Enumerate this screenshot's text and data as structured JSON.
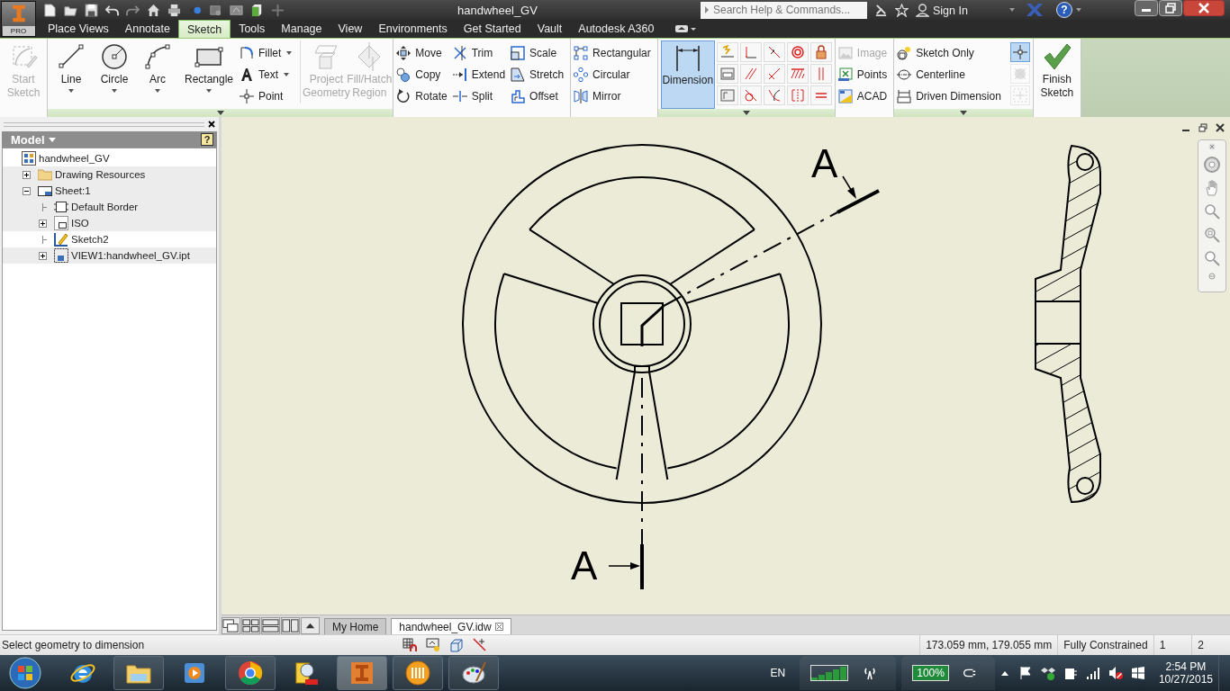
{
  "app_button": {
    "badge": "PRO"
  },
  "title_bar": {
    "title": "handwheel_GV",
    "search": {
      "placeholder": "Search Help & Commands..."
    },
    "sign_in": "Sign In",
    "help": "?"
  },
  "ribbon_tabs": [
    {
      "label": "Place Views",
      "selected": false
    },
    {
      "label": "Annotate",
      "selected": false
    },
    {
      "label": "Sketch",
      "selected": true
    },
    {
      "label": "Tools",
      "selected": false
    },
    {
      "label": "Manage",
      "selected": false
    },
    {
      "label": "View",
      "selected": false
    },
    {
      "label": "Environments",
      "selected": false
    },
    {
      "label": "Get Started",
      "selected": false
    },
    {
      "label": "Vault",
      "selected": false
    },
    {
      "label": "Autodesk A360",
      "selected": false
    }
  ],
  "ribbon_panels": [
    {
      "expandable": false,
      "groups": [
        {
          "kind": "large",
          "label": "Start Sketch",
          "disabled": true,
          "dropdown": false,
          "selected": false
        }
      ]
    },
    {
      "expandable": true,
      "groups": [
        {
          "kind": "large",
          "label": "Line",
          "disabled": false,
          "dropdown": true,
          "selected": false
        },
        {
          "kind": "large",
          "label": "Circle",
          "disabled": false,
          "dropdown": true,
          "selected": false
        },
        {
          "kind": "large",
          "label": "Arc",
          "disabled": false,
          "dropdown": true,
          "selected": false
        },
        {
          "kind": "large",
          "label": "Rectangle",
          "disabled": false,
          "dropdown": true,
          "selected": false
        },
        {
          "kind": "stack",
          "items": [
            {
              "label": "Fillet",
              "dropdown": true,
              "disabled": false
            },
            {
              "label": "Text",
              "dropdown": true,
              "disabled": false
            },
            {
              "label": "Point",
              "dropdown": false,
              "disabled": false
            }
          ]
        },
        {
          "kind": "separator"
        },
        {
          "kind": "large",
          "label": "Project Geometry",
          "disabled": true,
          "dropdown": false,
          "selected": false
        },
        {
          "kind": "large",
          "label": "Fill/Hatch Region",
          "disabled": true,
          "dropdown": false,
          "selected": false
        }
      ]
    },
    {
      "expandable": false,
      "groups": [
        {
          "kind": "stack",
          "items": [
            {
              "label": "Move",
              "dropdown": false,
              "disabled": false
            },
            {
              "label": "Copy",
              "dropdown": false,
              "disabled": false
            },
            {
              "label": "Rotate",
              "dropdown": false,
              "disabled": false
            }
          ]
        },
        {
          "kind": "stack",
          "items": [
            {
              "label": "Trim",
              "dropdown": false,
              "disabled": false
            },
            {
              "label": "Extend",
              "dropdown": false,
              "disabled": false
            },
            {
              "label": "Split",
              "dropdown": false,
              "disabled": false
            }
          ]
        },
        {
          "kind": "stack",
          "items": [
            {
              "label": "Scale",
              "dropdown": false,
              "disabled": false
            },
            {
              "label": "Stretch",
              "dropdown": false,
              "disabled": false
            },
            {
              "label": "Offset",
              "dropdown": false,
              "disabled": false
            }
          ]
        }
      ]
    },
    {
      "expandable": false,
      "groups": [
        {
          "kind": "stack",
          "items": [
            {
              "label": "Rectangular",
              "dropdown": false,
              "disabled": false
            },
            {
              "label": "Circular",
              "dropdown": false,
              "disabled": false
            },
            {
              "label": "Mirror",
              "dropdown": false,
              "disabled": false
            }
          ]
        }
      ]
    },
    {
      "expandable": true,
      "groups": [
        {
          "kind": "large",
          "label": "Dimension",
          "disabled": false,
          "dropdown": false,
          "selected": true
        },
        {
          "kind": "constraint-grid"
        }
      ]
    },
    {
      "expandable": false,
      "groups": [
        {
          "kind": "stack",
          "items": [
            {
              "label": "Image",
              "dropdown": false,
              "disabled": true
            },
            {
              "label": "Points",
              "dropdown": false,
              "disabled": false
            },
            {
              "label": "ACAD",
              "dropdown": false,
              "disabled": false
            }
          ]
        }
      ]
    },
    {
      "expandable": true,
      "groups": [
        {
          "kind": "stack",
          "items": [
            {
              "label": "Sketch Only",
              "dropdown": false,
              "disabled": false
            },
            {
              "label": "Centerline",
              "dropdown": false,
              "disabled": false
            },
            {
              "label": "Driven Dimension",
              "dropdown": false,
              "disabled": false
            }
          ]
        },
        {
          "kind": "toggles",
          "items": [
            {
              "selected": true,
              "disabled": false
            },
            {
              "selected": false,
              "disabled": true
            },
            {
              "selected": false,
              "disabled": true
            }
          ]
        }
      ]
    },
    {
      "expandable": false,
      "groups": [
        {
          "kind": "large",
          "label": "Finish Sketch",
          "disabled": false,
          "dropdown": false,
          "selected": false
        }
      ]
    }
  ],
  "browser": {
    "title": "Model",
    "help": "?",
    "tree": {
      "label": "handwheel_GV",
      "children": [
        {
          "label": "Drawing Resources",
          "expanded": false,
          "active": false
        },
        {
          "label": "Sheet:1",
          "expanded": true,
          "active": false,
          "children": [
            {
              "label": "Default Border",
              "active": false
            },
            {
              "label": "ISO",
              "expanded": false,
              "active": false
            },
            {
              "label": "Sketch2",
              "active": true
            },
            {
              "label": "VIEW1:handwheel_GV.ipt",
              "expanded": false,
              "active": false
            }
          ]
        }
      ]
    }
  },
  "drawing": {
    "section_labels": [
      "A",
      "A"
    ]
  },
  "document_tabs": [
    {
      "label": "My Home",
      "selected": false,
      "closable": false
    },
    {
      "label": "handwheel_GV.idw",
      "selected": true,
      "closable": true
    }
  ],
  "status_bar": {
    "message": "Select geometry to dimension",
    "coordinates": "173.059 mm, 179.055 mm",
    "constraint_status": "Fully Constrained",
    "field_4": "1",
    "field_5": "2"
  },
  "taskbar": {
    "apps": [
      {
        "running": false,
        "selected": false
      },
      {
        "running": true,
        "selected": false
      },
      {
        "running": false,
        "selected": false
      },
      {
        "running": true,
        "selected": false
      },
      {
        "running": false,
        "selected": false
      },
      {
        "running": true,
        "selected": true
      },
      {
        "running": true,
        "selected": false
      },
      {
        "running": true,
        "selected": false
      }
    ],
    "language": "EN",
    "battery": "100%",
    "time": "2:54 PM",
    "date": "10/27/2015"
  }
}
